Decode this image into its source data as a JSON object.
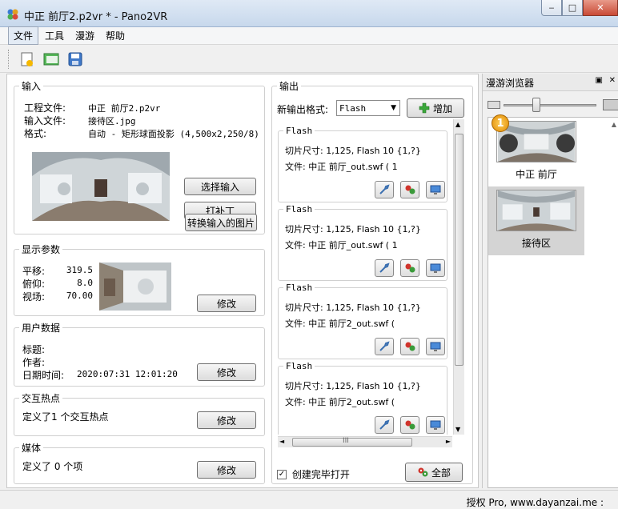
{
  "window": {
    "title": "中正 前厅2.p2vr * - Pano2VR",
    "minimize": "‒",
    "maximize": "□",
    "close": "✕"
  },
  "menu": [
    "文件",
    "工具",
    "漫游",
    "帮助"
  ],
  "toolbar": {
    "icons": [
      "new-project-icon",
      "open-project-icon",
      "save-icon"
    ]
  },
  "input": {
    "legend": "输入",
    "project_label": "工程文件:",
    "project_value": "中正 前厅2.p2vr",
    "input_label": "输入文件:",
    "input_value": "接待区.jpg",
    "format_label": "格式:",
    "format_value": "自动 - 矩形球面投影 (4,500x2,250/8)",
    "select_button": "选择输入",
    "patch_button": "打补丁",
    "convert_button": "转换输入的图片"
  },
  "display": {
    "legend": "显示参数",
    "pan_label": "平移:",
    "pan_value": "319.5",
    "tilt_label": "俯仰:",
    "tilt_value": "8.0",
    "fov_label": "视场:",
    "fov_value": "70.00",
    "modify_button": "修改"
  },
  "userdata": {
    "legend": "用户数据",
    "title_label": "标题:",
    "author_label": "作者:",
    "datetime_label": "日期时间:",
    "datetime_value": "2020:07:31 12:01:20",
    "modify_button": "修改"
  },
  "hotspots": {
    "legend": "交互热点",
    "text": "定义了1 个交互热点",
    "modify_button": "修改"
  },
  "media": {
    "legend": "媒体",
    "text": "定义了 0 个项",
    "modify_button": "修改"
  },
  "output": {
    "legend": "输出",
    "new_format_label": "新输出格式:",
    "format_selected": "Flash",
    "add_button": "增加",
    "items": [
      {
        "title": "Flash",
        "line1": "切片尺寸: 1,125, Flash 10 {1,?}",
        "line2": "文件: 中正 前厅_out.swf (       1"
      },
      {
        "title": "Flash",
        "line1": "切片尺寸: 1,125, Flash 10 {1,?}",
        "line2": "文件: 中正 前厅_out.swf (       1"
      },
      {
        "title": "Flash",
        "line1": "切片尺寸: 1,125, Flash 10 {1,?}",
        "line2": "文件: 中正 前厅2_out.swf ("
      },
      {
        "title": "Flash",
        "line1": "切片尺寸: 1,125, Flash 10 {1,?}",
        "line2": "文件: 中正 前厅2_out.swf ("
      }
    ],
    "open_after_label": "创建完毕打开",
    "open_after_checked": true,
    "all_button": "全部",
    "hscroll_grip": "III"
  },
  "tour_browser": {
    "title": "漫游浏览器",
    "badge": "1",
    "nodes": [
      {
        "label": "中正 前厅",
        "selected": false
      },
      {
        "label": "接待区",
        "selected": true
      }
    ]
  },
  "status": {
    "text": "授权 Pro, www.dayanzai.me :"
  }
}
